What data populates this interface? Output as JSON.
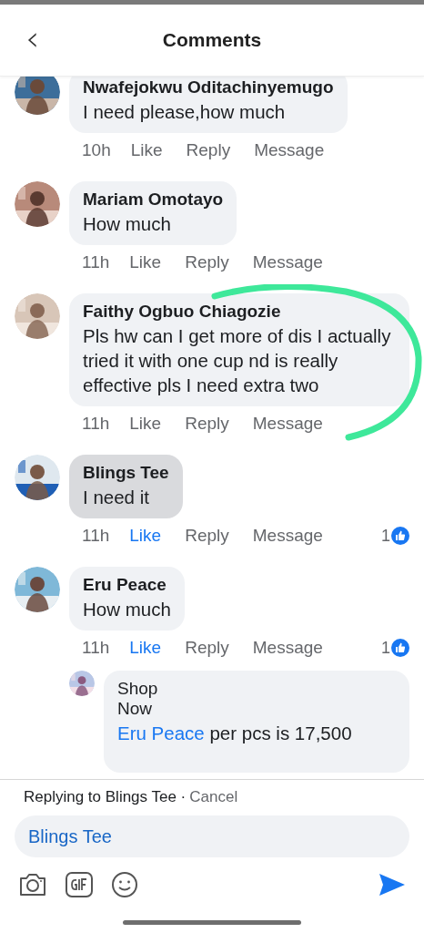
{
  "header": {
    "back": "‹",
    "title": "Comments"
  },
  "comments": [
    {
      "name": "Nwafejokwu Oditachinyemugo",
      "text": "I need please,how much",
      "time": "10h",
      "like": "Like",
      "liked": false,
      "reply": "Reply",
      "message": "Message",
      "highlighted": false
    },
    {
      "name": "Mariam Omotayo",
      "text": "How much",
      "time": "11h",
      "like": "Like",
      "liked": false,
      "reply": "Reply",
      "message": "Message",
      "highlighted": false
    },
    {
      "name": "Faithy Ogbuo Chiagozie",
      "text": "Pls hw can I get more of dis I actually tried it with one cup nd is really effective pls I need extra two",
      "time": "11h",
      "like": "Like",
      "liked": false,
      "reply": "Reply",
      "message": "Message",
      "highlighted": false
    },
    {
      "name": "Blings Tee",
      "text": "I need it",
      "time": "11h",
      "like": "Like",
      "liked": true,
      "reply": "Reply",
      "message": "Message",
      "highlighted": true,
      "reactions": "1"
    },
    {
      "name": "Eru Peace",
      "text": "How much",
      "time": "11h",
      "like": "Like",
      "liked": true,
      "reply": "Reply",
      "message": "Message",
      "highlighted": false,
      "reactions": "1",
      "replies": [
        {
          "name": "Shop Now",
          "mention": "Eru Peace",
          "text": "per pcs is 17,500"
        }
      ]
    }
  ],
  "composer": {
    "replying_to": "Replying to Blings Tee ·",
    "cancel": "Cancel",
    "value": "Blings Tee"
  }
}
